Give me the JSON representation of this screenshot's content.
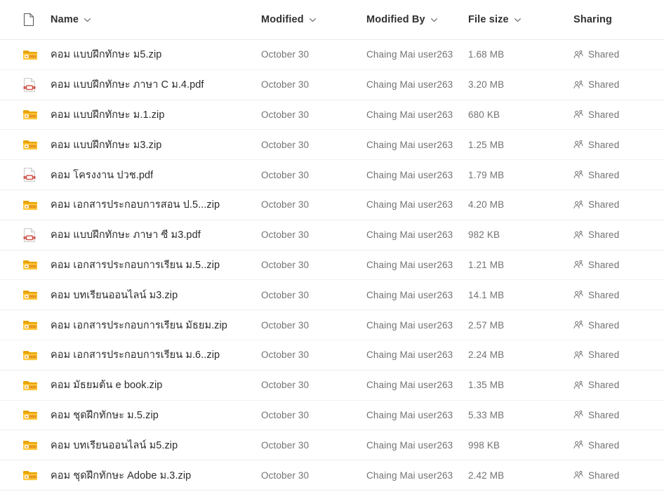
{
  "header": {
    "icon": "document-icon",
    "columns": [
      {
        "label": "Name",
        "sortable": true,
        "name": "name"
      },
      {
        "label": "Modified",
        "sortable": true,
        "name": "modified"
      },
      {
        "label": "Modified By",
        "sortable": true,
        "name": "modified-by"
      },
      {
        "label": "File size",
        "sortable": true,
        "name": "file-size"
      },
      {
        "label": "Sharing",
        "sortable": false,
        "name": "sharing"
      }
    ]
  },
  "colors": {
    "zip_folder": "#e8a400",
    "zip_folder_light": "#ffc83d",
    "pdf_accent": "#d0584f",
    "text_primary": "#2b2b2b",
    "text_secondary": "#737373",
    "row_divider": "#f0f0f0",
    "header_divider": "#ebebeb",
    "background": "#ffffff"
  },
  "rows": [
    {
      "icon": "zip-folder-icon",
      "name": "คอม แบบฝึกทักษะ ม5.zip",
      "modified": "October 30",
      "modified_by": "Chaing Mai user263",
      "size": "1.68 MB",
      "sharing": "Shared"
    },
    {
      "icon": "pdf-file-icon",
      "name": "คอม แบบฝึกทักษะ ภาษา C ม.4.pdf",
      "modified": "October 30",
      "modified_by": "Chaing Mai user263",
      "size": "3.20 MB",
      "sharing": "Shared"
    },
    {
      "icon": "zip-folder-icon",
      "name": "คอม แบบฝึกทักษะ ม.1.zip",
      "modified": "October 30",
      "modified_by": "Chaing Mai user263",
      "size": "680 KB",
      "sharing": "Shared"
    },
    {
      "icon": "zip-folder-icon",
      "name": "คอม แบบฝึกทักษะ ม3.zip",
      "modified": "October 30",
      "modified_by": "Chaing Mai user263",
      "size": "1.25 MB",
      "sharing": "Shared"
    },
    {
      "icon": "pdf-file-icon",
      "name": "คอม โครงงาน ปวช.pdf",
      "modified": "October 30",
      "modified_by": "Chaing Mai user263",
      "size": "1.79 MB",
      "sharing": "Shared"
    },
    {
      "icon": "zip-folder-icon",
      "name": "คอม เอกสารประกอบการสอน ป.5...zip",
      "modified": "October 30",
      "modified_by": "Chaing Mai user263",
      "size": "4.20 MB",
      "sharing": "Shared"
    },
    {
      "icon": "pdf-file-icon",
      "name": "คอม แบบฝึกทักษะ ภาษา ซี ม3.pdf",
      "modified": "October 30",
      "modified_by": "Chaing Mai user263",
      "size": "982 KB",
      "sharing": "Shared"
    },
    {
      "icon": "zip-folder-icon",
      "name": "คอม เอกสารประกอบการเรียน ม.5..zip",
      "modified": "October 30",
      "modified_by": "Chaing Mai user263",
      "size": "1.21 MB",
      "sharing": "Shared"
    },
    {
      "icon": "zip-folder-icon",
      "name": "คอม บทเรียนออนไลน์ ม3.zip",
      "modified": "October 30",
      "modified_by": "Chaing Mai user263",
      "size": "14.1 MB",
      "sharing": "Shared"
    },
    {
      "icon": "zip-folder-icon",
      "name": "คอม เอกสารประกอบการเรียน มัธยม.zip",
      "modified": "October 30",
      "modified_by": "Chaing Mai user263",
      "size": "2.57 MB",
      "sharing": "Shared"
    },
    {
      "icon": "zip-folder-icon",
      "name": "คอม เอกสารประกอบการเรียน ม.6..zip",
      "modified": "October 30",
      "modified_by": "Chaing Mai user263",
      "size": "2.24 MB",
      "sharing": "Shared"
    },
    {
      "icon": "zip-folder-icon",
      "name": "คอม มัธยมต้น e book.zip",
      "modified": "October 30",
      "modified_by": "Chaing Mai user263",
      "size": "1.35 MB",
      "sharing": "Shared"
    },
    {
      "icon": "zip-folder-icon",
      "name": "คอม ชุดฝึกทักษะ ม.5.zip",
      "modified": "October 30",
      "modified_by": "Chaing Mai user263",
      "size": "5.33 MB",
      "sharing": "Shared"
    },
    {
      "icon": "zip-folder-icon",
      "name": "คอม บทเรียนออนไลน์ ม5.zip",
      "modified": "October 30",
      "modified_by": "Chaing Mai user263",
      "size": "998 KB",
      "sharing": "Shared"
    },
    {
      "icon": "zip-folder-icon",
      "name": "คอม ชุดฝึกทักษะ Adobe ม.3.zip",
      "modified": "October 30",
      "modified_by": "Chaing Mai user263",
      "size": "2.42 MB",
      "sharing": "Shared"
    }
  ]
}
